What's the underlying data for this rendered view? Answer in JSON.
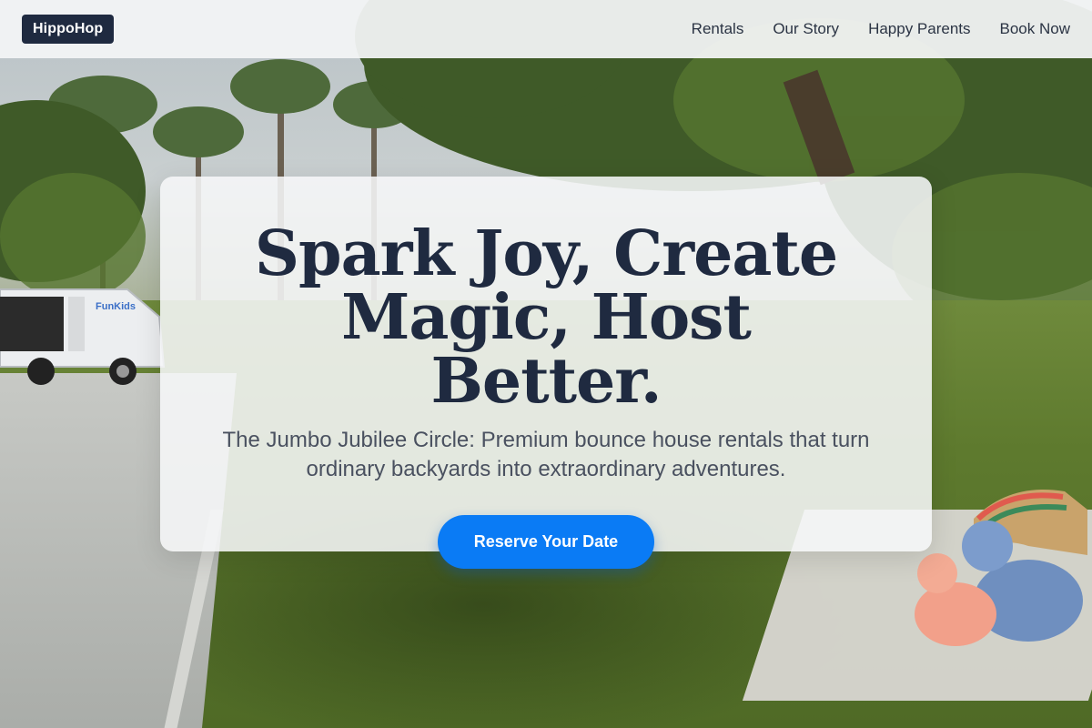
{
  "brand": {
    "logo": "HippoHop"
  },
  "nav": {
    "links": [
      "Rentals",
      "Our Story",
      "Happy Parents",
      "Book Now"
    ]
  },
  "hero": {
    "title": "Spark Joy, Create Magic, Host Better.",
    "subtitle": "The Jumbo Jubilee Circle: Premium bounce house rentals that turn ordinary backyards into extraordinary adventures.",
    "cta_label": "Reserve Your Date"
  },
  "background": {
    "description_icon": "backyard-park-photo",
    "van_lettering": "FunKids"
  },
  "colors": {
    "logo_bg": "#1f2a40",
    "title": "#1f2a40",
    "cta": "#0a7bf5"
  }
}
